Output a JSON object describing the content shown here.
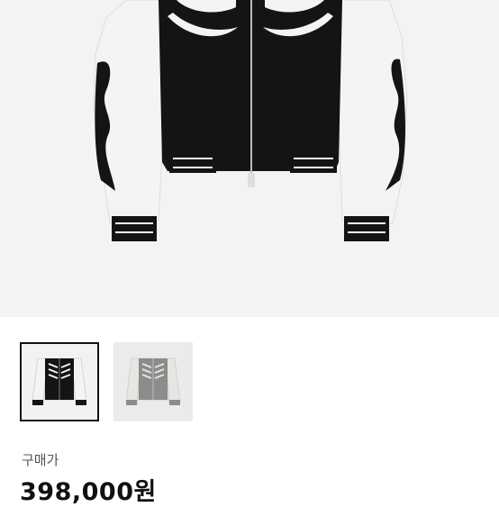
{
  "product": {
    "images": [
      {
        "icon": "black-skeleton-varsity-jacket",
        "selected": true
      },
      {
        "icon": "grey-skeleton-varsity-jacket",
        "selected": false
      }
    ]
  },
  "purchase": {
    "label": "구매가",
    "price": "398,000원"
  },
  "colors": {
    "jacket_body": "#141414",
    "jacket_sleeve": "#f4f4f4",
    "background": "#f3f3f3",
    "alt_body": "#8c8c8c"
  }
}
